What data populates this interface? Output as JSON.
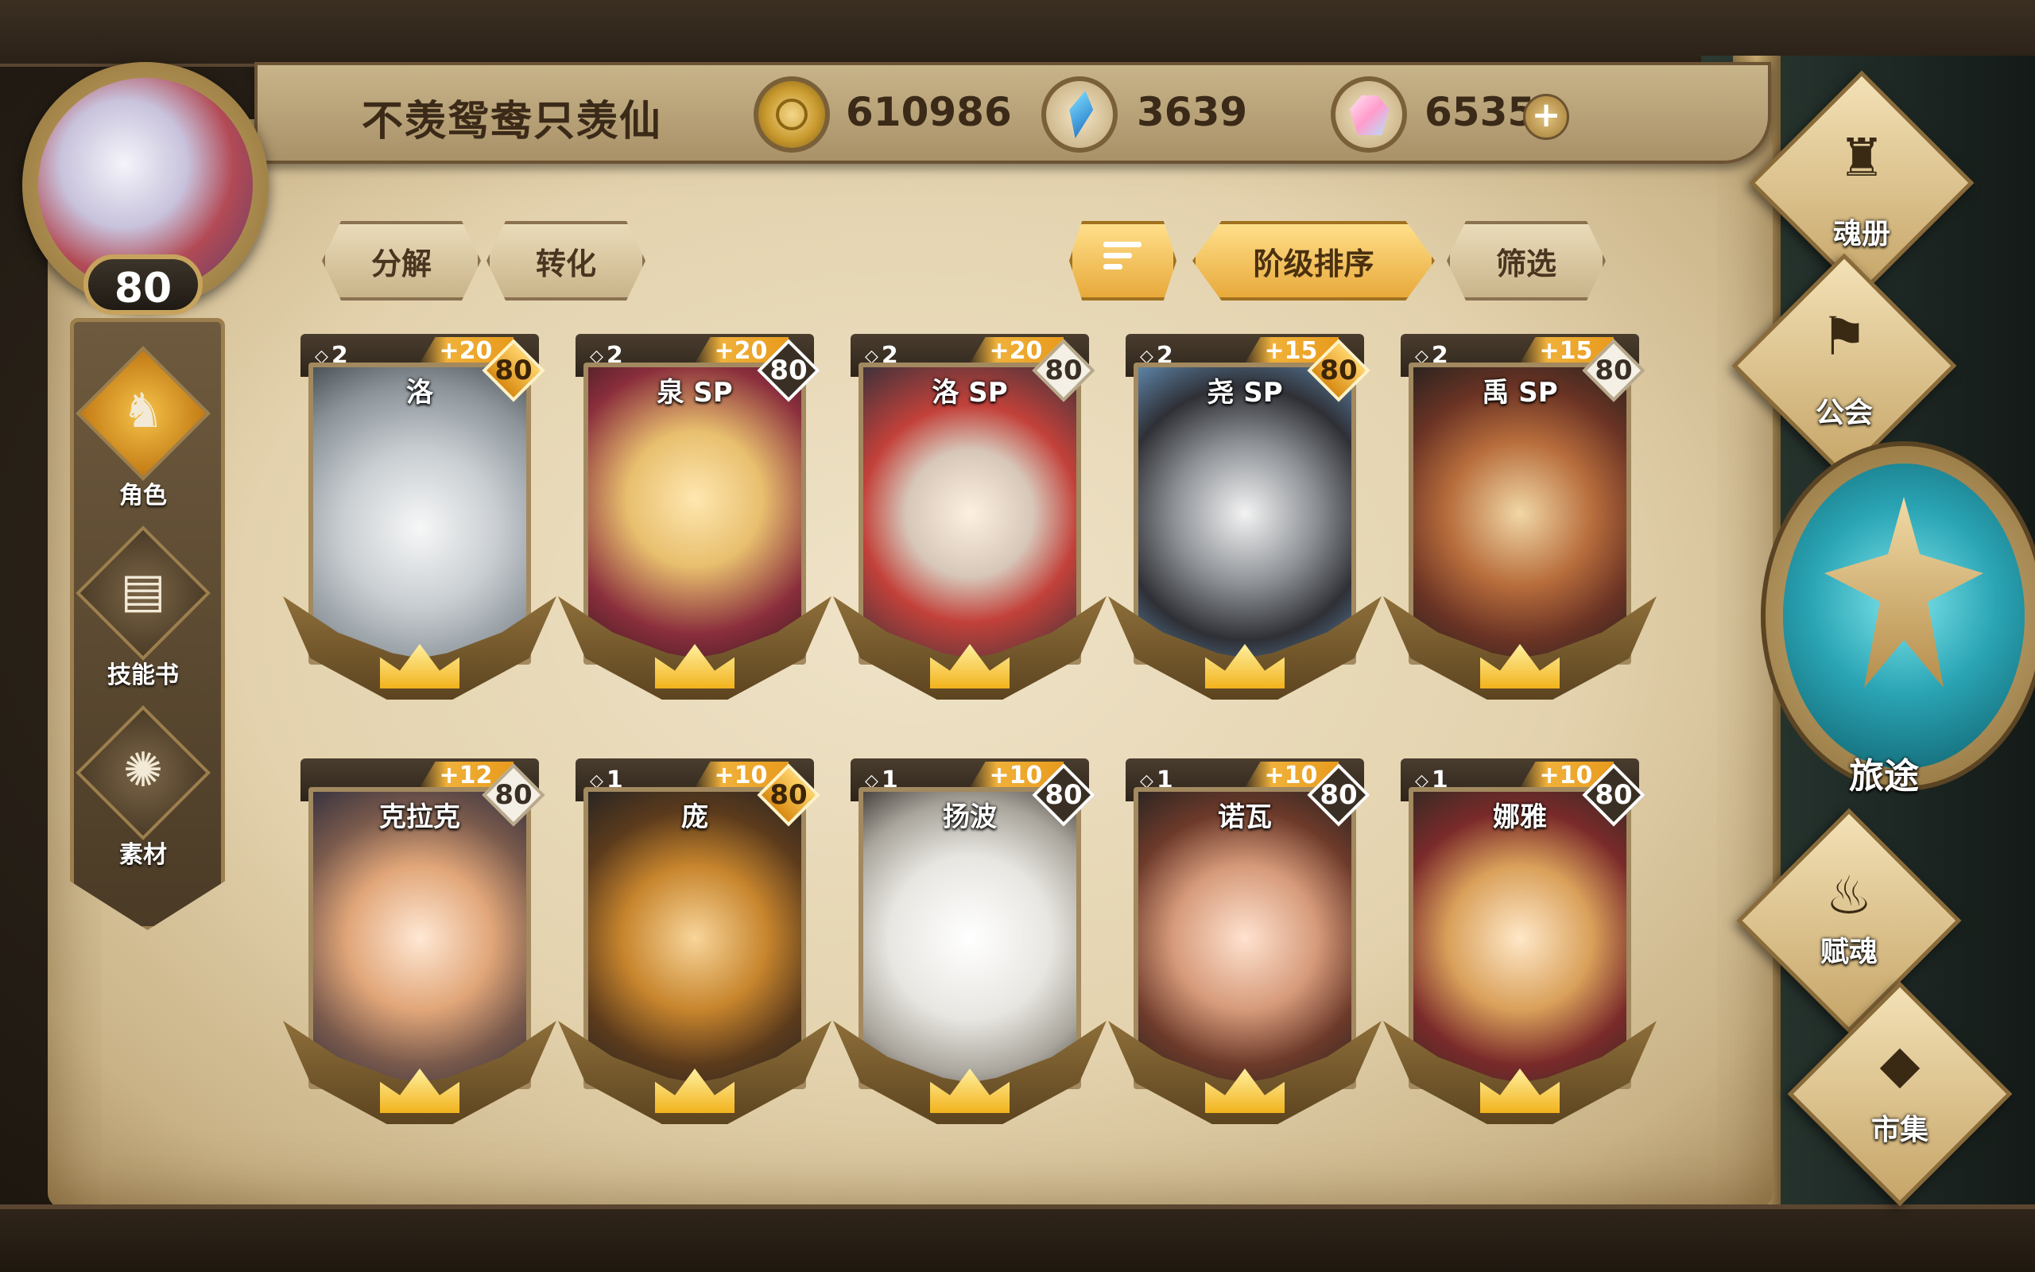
{
  "player": {
    "name": "不羡鸳鸯只羡仙",
    "level": "80"
  },
  "currencies": [
    {
      "icon": "gold-coin-icon",
      "value": "610986"
    },
    {
      "icon": "blue-crystal-icon",
      "value": "3639"
    },
    {
      "icon": "pink-gem-icon",
      "value": "6535"
    }
  ],
  "add_button": "+",
  "left_nav": [
    {
      "label": "角色",
      "icon": "character-icon",
      "active": true
    },
    {
      "label": "技能书",
      "icon": "skill-book-icon",
      "active": false
    },
    {
      "label": "素材",
      "icon": "material-icon",
      "active": false
    }
  ],
  "actions": {
    "decompose": "分解",
    "convert": "转化",
    "rank_sort": "阶级排序",
    "filter": "筛选"
  },
  "cards": [
    {
      "name": "洛",
      "stage": "2",
      "plus": "+20",
      "level": "80"
    },
    {
      "name": "泉 SP",
      "stage": "2",
      "plus": "+20",
      "level": "80"
    },
    {
      "name": "洛 SP",
      "stage": "2",
      "plus": "+20",
      "level": "80"
    },
    {
      "name": "尧 SP",
      "stage": "2",
      "plus": "+15",
      "level": "80"
    },
    {
      "name": "禹 SP",
      "stage": "2",
      "plus": "+15",
      "level": "80"
    },
    {
      "name": "克拉克",
      "stage": "",
      "plus": "+12",
      "level": "80"
    },
    {
      "name": "庞",
      "stage": "1",
      "plus": "+10",
      "level": "80"
    },
    {
      "name": "扬波",
      "stage": "1",
      "plus": "+10",
      "level": "80"
    },
    {
      "name": "诺瓦",
      "stage": "1",
      "plus": "+10",
      "level": "80"
    },
    {
      "name": "娜雅",
      "stage": "1",
      "plus": "+10",
      "level": "80"
    }
  ],
  "right_nav": {
    "soul_book": "魂册",
    "guild": "公会",
    "journey": "旅途",
    "soul_endow": "赋魂",
    "market": "市集"
  },
  "colors": {
    "accent_gold": "#f0b13a",
    "parchment": "#e3d2ad",
    "journey_teal": "#2aa4b4"
  }
}
